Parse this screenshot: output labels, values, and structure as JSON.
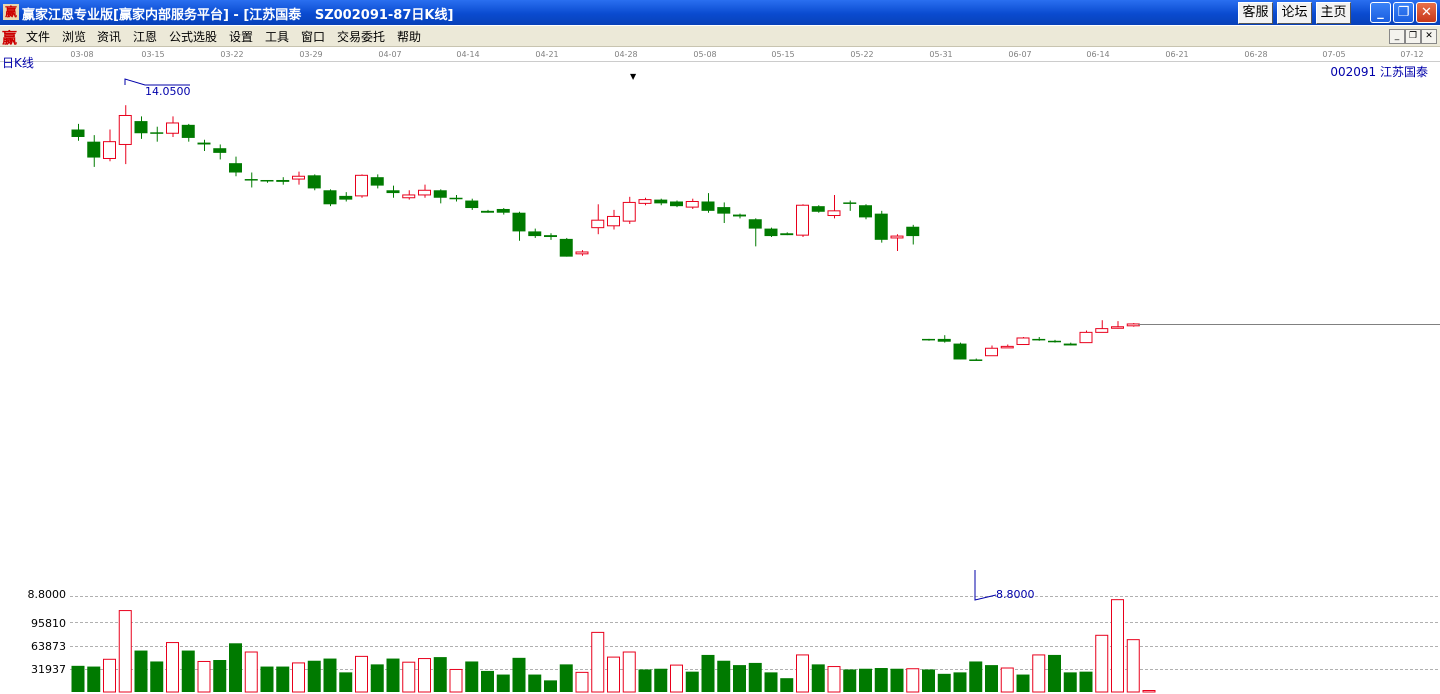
{
  "window": {
    "app_icon_glyph": "赢",
    "title": "赢家江恩专业版[赢家内部服务平台] - [江苏国泰   SZ002091-87日K线]",
    "buttons": {
      "service": "客服",
      "forum": "论坛",
      "home": "主页"
    },
    "controls": {
      "minimize": "_",
      "restore": "❐",
      "close": "✕"
    }
  },
  "menu": {
    "icon_glyph": "赢",
    "items": [
      "文件",
      "浏览",
      "资讯",
      "江恩",
      "公式选股",
      "设置",
      "工具",
      "窗口",
      "交易委托",
      "帮助"
    ],
    "mdi_controls": [
      "_",
      "❐",
      "✕"
    ]
  },
  "date_axis": [
    "03-08",
    "03-15",
    "03-22",
    "03-29",
    "04-07",
    "04-14",
    "04-21",
    "04-28",
    "05-08",
    "05-15",
    "05-22",
    "05-31",
    "06-07",
    "06-14",
    "06-21",
    "06-28",
    "07-05",
    "07-12"
  ],
  "chart": {
    "title": "日K线",
    "stock": "002091  江苏国泰",
    "marker": "▼",
    "high_note": "14.0500",
    "low_note": "8.8000",
    "low_axis_label": "8.8000",
    "volume_axis_labels": [
      "95810",
      "63873",
      "31937"
    ]
  },
  "colors": {
    "up": "#e8001c",
    "down": "#007a00",
    "accent_blue": "#0000aa",
    "grid": "#a0a0a0"
  },
  "chart_data": {
    "type": "candlestick",
    "candles": [
      [
        13.71,
        13.79,
        13.85,
        13.67,
        "d"
      ],
      [
        13.66,
        13.49,
        13.73,
        13.39,
        "d"
      ],
      [
        13.48,
        13.66,
        13.79,
        13.45,
        "u"
      ],
      [
        13.63,
        13.94,
        14.05,
        13.42,
        "u"
      ],
      [
        13.88,
        13.75,
        13.93,
        13.69,
        "d"
      ],
      [
        13.76,
        13.75,
        13.82,
        13.66,
        "d"
      ],
      [
        13.75,
        13.86,
        13.93,
        13.71,
        "u"
      ],
      [
        13.84,
        13.7,
        13.85,
        13.66,
        "d"
      ],
      [
        13.65,
        13.63,
        13.68,
        13.56,
        "d"
      ],
      [
        13.59,
        13.54,
        13.63,
        13.47,
        "d"
      ],
      [
        13.43,
        13.33,
        13.5,
        13.29,
        "d"
      ],
      [
        13.26,
        13.26,
        13.33,
        13.17,
        "d"
      ],
      [
        13.25,
        13.24,
        13.25,
        13.22,
        "d"
      ],
      [
        13.23,
        13.25,
        13.28,
        13.2,
        "d"
      ],
      [
        13.26,
        13.29,
        13.34,
        13.2,
        "u"
      ],
      [
        13.3,
        13.16,
        13.31,
        13.14,
        "d"
      ],
      [
        13.14,
        12.99,
        13.15,
        12.97,
        "d"
      ],
      [
        13.04,
        13.08,
        13.12,
        13.02,
        "d"
      ],
      [
        13.08,
        13.3,
        13.31,
        13.06,
        "u"
      ],
      [
        13.28,
        13.19,
        13.31,
        13.16,
        "d"
      ],
      [
        13.14,
        13.11,
        13.19,
        13.06,
        "d"
      ],
      [
        13.06,
        13.09,
        13.14,
        13.04,
        "u"
      ],
      [
        13.09,
        13.14,
        13.2,
        13.06,
        "u"
      ],
      [
        13.14,
        13.06,
        13.15,
        13.0,
        "d"
      ],
      [
        13.06,
        13.05,
        13.09,
        13.02,
        "d"
      ],
      [
        13.03,
        12.95,
        13.05,
        12.93,
        "d"
      ],
      [
        12.92,
        12.9,
        12.93,
        12.9,
        "d"
      ],
      [
        12.94,
        12.9,
        12.95,
        12.88,
        "d"
      ],
      [
        12.9,
        12.7,
        12.91,
        12.6,
        "d"
      ],
      [
        12.7,
        12.65,
        12.73,
        12.63,
        "d"
      ],
      [
        12.66,
        12.64,
        12.68,
        12.61,
        "d"
      ],
      [
        12.62,
        12.43,
        12.63,
        12.43,
        "d"
      ],
      [
        12.46,
        12.48,
        12.5,
        12.44,
        "u"
      ],
      [
        12.74,
        12.82,
        12.99,
        12.67,
        "u"
      ],
      [
        12.76,
        12.86,
        12.93,
        12.72,
        "u"
      ],
      [
        12.81,
        13.01,
        13.07,
        12.78,
        "u"
      ],
      [
        13.0,
        13.04,
        13.06,
        12.98,
        "u"
      ],
      [
        13.04,
        13.0,
        13.05,
        12.98,
        "d"
      ],
      [
        13.02,
        12.97,
        13.03,
        12.96,
        "d"
      ],
      [
        12.96,
        13.02,
        13.05,
        12.94,
        "u"
      ],
      [
        13.02,
        12.92,
        13.11,
        12.9,
        "d"
      ],
      [
        12.96,
        12.89,
        13.01,
        12.79,
        "d"
      ],
      [
        12.88,
        12.86,
        12.89,
        12.84,
        "d"
      ],
      [
        12.83,
        12.73,
        12.84,
        12.54,
        "d"
      ],
      [
        12.73,
        12.65,
        12.74,
        12.64,
        "d"
      ],
      [
        12.68,
        12.66,
        12.69,
        12.66,
        "d"
      ],
      [
        12.66,
        12.98,
        12.99,
        12.64,
        "u"
      ],
      [
        12.97,
        12.91,
        12.98,
        12.9,
        "d"
      ],
      [
        12.87,
        12.92,
        13.09,
        12.84,
        "u"
      ],
      [
        13.01,
        13.0,
        13.03,
        12.92,
        "d"
      ],
      [
        12.98,
        12.85,
        12.99,
        12.83,
        "d"
      ],
      [
        12.89,
        12.61,
        12.92,
        12.58,
        "d"
      ],
      [
        12.63,
        12.65,
        12.67,
        12.49,
        "u"
      ],
      [
        12.75,
        12.65,
        12.77,
        12.56,
        "d"
      ],
      [
        11.54,
        11.55,
        11.55,
        11.53,
        "d"
      ],
      [
        11.55,
        11.52,
        11.59,
        11.51,
        "d"
      ],
      [
        11.5,
        11.33,
        11.51,
        11.33,
        "d"
      ],
      [
        11.33,
        11.33,
        11.34,
        11.32,
        "d"
      ],
      [
        11.37,
        11.45,
        11.48,
        11.37,
        "u"
      ],
      [
        11.46,
        11.47,
        11.49,
        11.46,
        "u"
      ],
      [
        11.49,
        11.56,
        11.57,
        11.49,
        "u"
      ],
      [
        11.55,
        11.54,
        11.57,
        11.53,
        "d"
      ],
      [
        11.53,
        11.52,
        11.54,
        11.51,
        "d"
      ],
      [
        11.5,
        11.48,
        11.51,
        11.48,
        "d"
      ],
      [
        11.51,
        11.62,
        11.64,
        11.51,
        "u"
      ],
      [
        11.62,
        11.66,
        11.75,
        11.62,
        "u"
      ],
      [
        11.67,
        11.68,
        11.74,
        11.66,
        "u"
      ],
      [
        11.69,
        11.71,
        11.72,
        11.68,
        "u"
      ]
    ],
    "volumes": [
      [
        36000,
        "d"
      ],
      [
        35000,
        "d"
      ],
      [
        45000,
        "u"
      ],
      [
        112000,
        "u"
      ],
      [
        57000,
        "d"
      ],
      [
        42000,
        "d"
      ],
      [
        68000,
        "u"
      ],
      [
        57000,
        "d"
      ],
      [
        42000,
        "u"
      ],
      [
        44000,
        "d"
      ],
      [
        67000,
        "d"
      ],
      [
        55000,
        "u"
      ],
      [
        35000,
        "d"
      ],
      [
        35000,
        "d"
      ],
      [
        40000,
        "u"
      ],
      [
        43000,
        "d"
      ],
      [
        46000,
        "d"
      ],
      [
        27000,
        "d"
      ],
      [
        49000,
        "u"
      ],
      [
        38000,
        "d"
      ],
      [
        46000,
        "d"
      ],
      [
        41000,
        "u"
      ],
      [
        46000,
        "u"
      ],
      [
        48000,
        "d"
      ],
      [
        31000,
        "u"
      ],
      [
        42000,
        "d"
      ],
      [
        29000,
        "d"
      ],
      [
        24000,
        "d"
      ],
      [
        47000,
        "d"
      ],
      [
        24000,
        "d"
      ],
      [
        16000,
        "d"
      ],
      [
        38000,
        "d"
      ],
      [
        27000,
        "u"
      ],
      [
        82000,
        "u"
      ],
      [
        48000,
        "u"
      ],
      [
        55000,
        "u"
      ],
      [
        31000,
        "d"
      ],
      [
        32000,
        "d"
      ],
      [
        37000,
        "u"
      ],
      [
        28000,
        "d"
      ],
      [
        51000,
        "d"
      ],
      [
        43000,
        "d"
      ],
      [
        37000,
        "d"
      ],
      [
        40000,
        "d"
      ],
      [
        27000,
        "d"
      ],
      [
        19000,
        "d"
      ],
      [
        51000,
        "u"
      ],
      [
        38000,
        "d"
      ],
      [
        35000,
        "u"
      ],
      [
        31000,
        "d"
      ],
      [
        32000,
        "d"
      ],
      [
        33000,
        "d"
      ],
      [
        32000,
        "d"
      ],
      [
        32000,
        "u"
      ],
      [
        31000,
        "d"
      ],
      [
        25000,
        "d"
      ],
      [
        27000,
        "d"
      ],
      [
        42000,
        "d"
      ],
      [
        37000,
        "d"
      ],
      [
        33000,
        "u"
      ],
      [
        24000,
        "d"
      ],
      [
        51000,
        "u"
      ],
      [
        51000,
        "d"
      ],
      [
        27000,
        "d"
      ],
      [
        28000,
        "d"
      ],
      [
        78000,
        "u"
      ],
      [
        127000,
        "u"
      ],
      [
        72000,
        "u"
      ],
      [
        2000,
        "u"
      ]
    ],
    "price_axis_min": 8.8,
    "volume_ticks": [
      31937,
      63873,
      95810
    ]
  }
}
